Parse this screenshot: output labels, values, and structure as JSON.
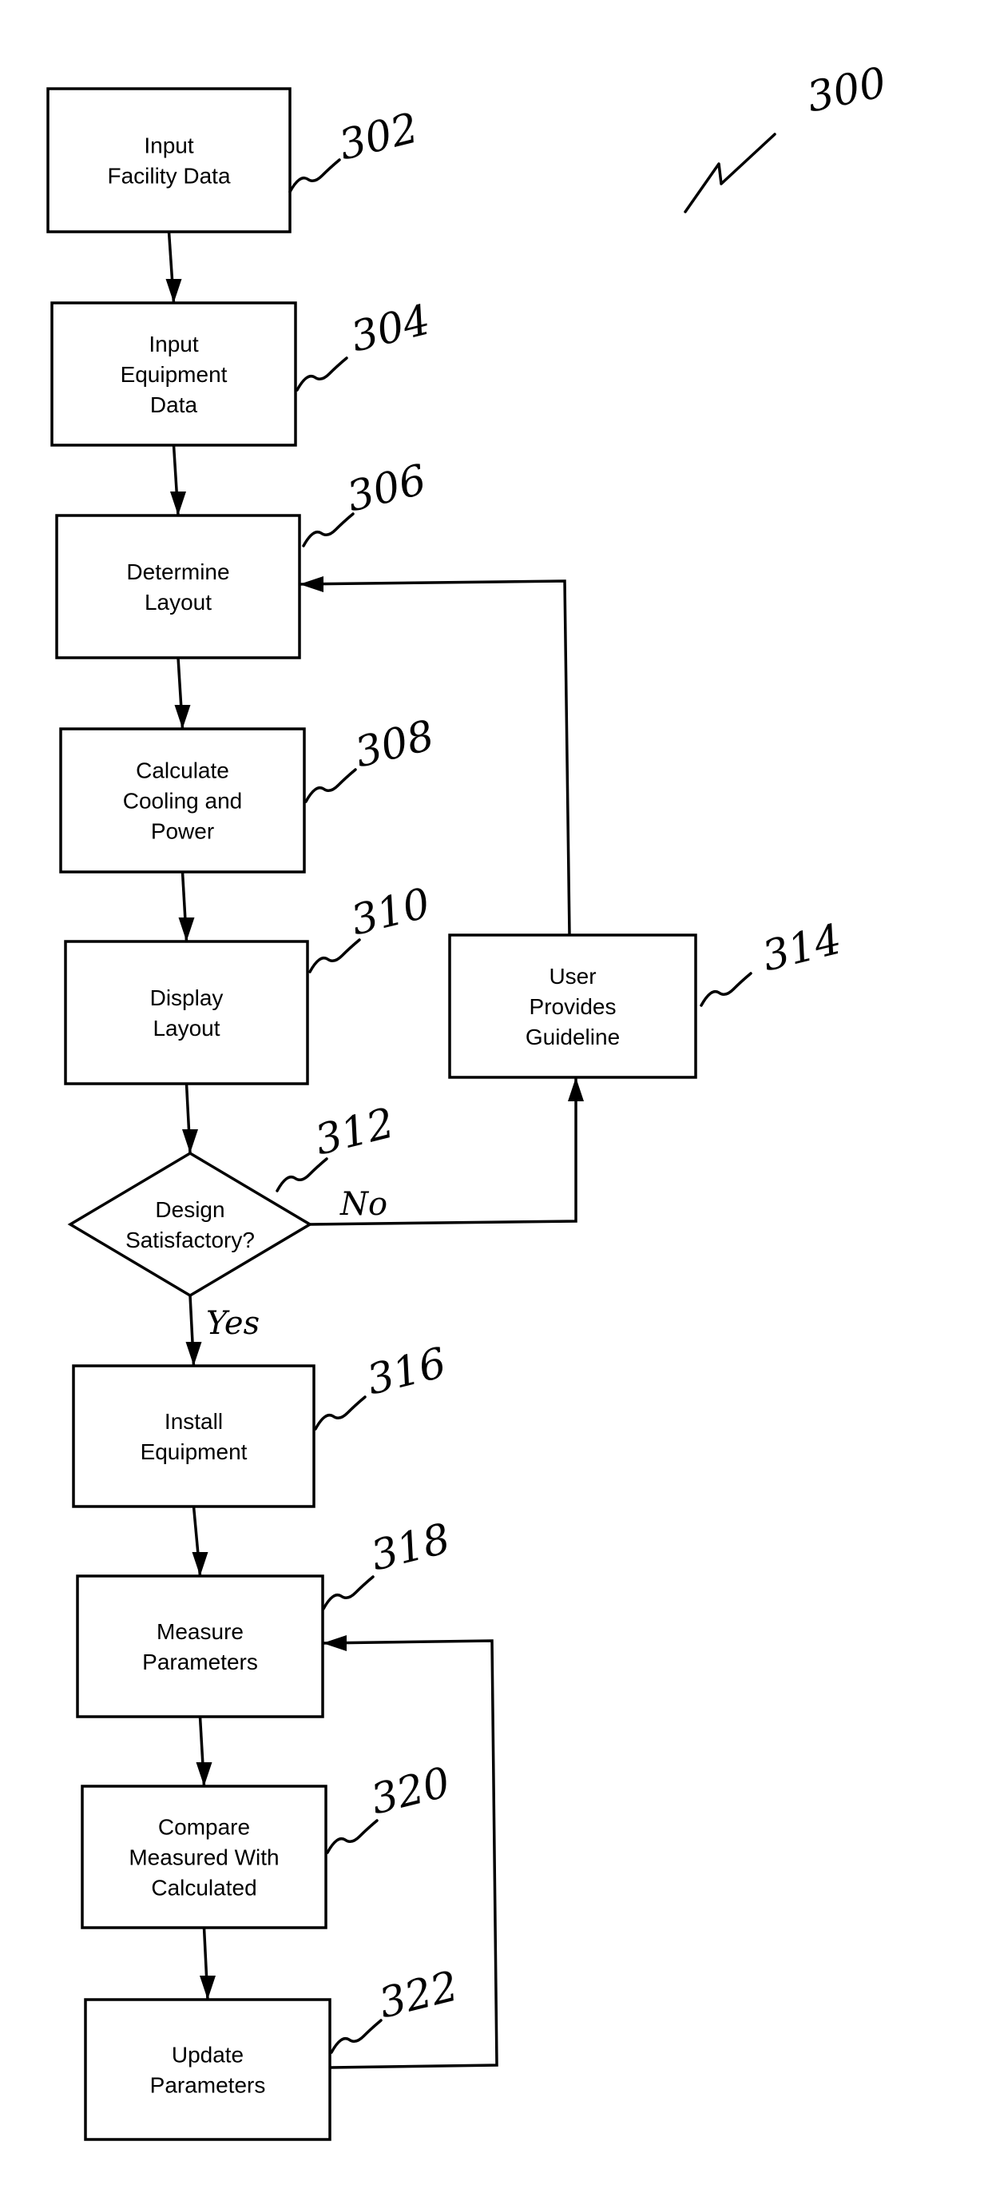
{
  "figure": {
    "reference": "300",
    "nodes": [
      {
        "id": "302",
        "shape": "rect",
        "lines": [
          "Input",
          "Facility Data"
        ]
      },
      {
        "id": "304",
        "shape": "rect",
        "lines": [
          "Input",
          "Equipment",
          "Data"
        ]
      },
      {
        "id": "306",
        "shape": "rect",
        "lines": [
          "Determine",
          "Layout"
        ]
      },
      {
        "id": "308",
        "shape": "rect",
        "lines": [
          "Calculate",
          "Cooling and",
          "Power"
        ]
      },
      {
        "id": "310",
        "shape": "rect",
        "lines": [
          "Display",
          "Layout"
        ]
      },
      {
        "id": "312",
        "shape": "diamond",
        "lines": [
          "Design",
          "Satisfactory?"
        ]
      },
      {
        "id": "314",
        "shape": "rect",
        "lines": [
          "User",
          "Provides",
          "Guideline"
        ]
      },
      {
        "id": "316",
        "shape": "rect",
        "lines": [
          "Install",
          "Equipment"
        ]
      },
      {
        "id": "318",
        "shape": "rect",
        "lines": [
          "Measure",
          "Parameters"
        ]
      },
      {
        "id": "320",
        "shape": "rect",
        "lines": [
          "Compare",
          "Measured With",
          "Calculated"
        ]
      },
      {
        "id": "322",
        "shape": "rect",
        "lines": [
          "Update",
          "Parameters"
        ]
      }
    ],
    "edges": [
      {
        "from": "302",
        "to": "304"
      },
      {
        "from": "304",
        "to": "306"
      },
      {
        "from": "306",
        "to": "308"
      },
      {
        "from": "308",
        "to": "310"
      },
      {
        "from": "310",
        "to": "312"
      },
      {
        "from": "312",
        "to": "316",
        "label": "Yes"
      },
      {
        "from": "312",
        "to": "314",
        "label": "No"
      },
      {
        "from": "314",
        "to": "306"
      },
      {
        "from": "316",
        "to": "318"
      },
      {
        "from": "318",
        "to": "320"
      },
      {
        "from": "320",
        "to": "322"
      },
      {
        "from": "322",
        "to": "318"
      }
    ]
  }
}
